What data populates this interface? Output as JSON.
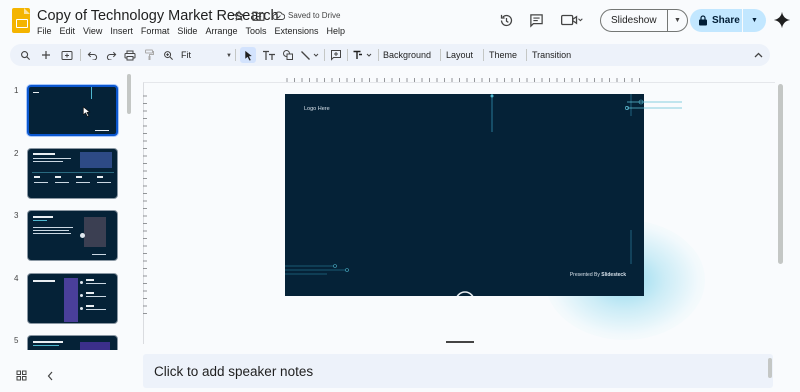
{
  "app": {
    "title": "Copy of Technology Market Research",
    "save_status": "Saved to Drive",
    "menu": [
      "File",
      "Edit",
      "View",
      "Insert",
      "Format",
      "Slide",
      "Arrange",
      "Tools",
      "Extensions",
      "Help"
    ],
    "slideshow_label": "Slideshow",
    "share_label": "Share"
  },
  "toolbar": {
    "zoom_label": "Fit",
    "background_label": "Background",
    "layout_label": "Layout",
    "theme_label": "Theme",
    "transition_label": "Transition"
  },
  "filmstrip": {
    "slides": [
      {
        "number": "1",
        "selected": true
      },
      {
        "number": "2",
        "selected": false
      },
      {
        "number": "3",
        "selected": false
      },
      {
        "number": "4",
        "selected": false
      },
      {
        "number": "5",
        "selected": false
      }
    ]
  },
  "slide": {
    "logo_text": "Logo Here",
    "footer_prefix": "Presented By",
    "footer_brand": "Slidesteck"
  },
  "notes": {
    "placeholder": "Click to add speaker notes"
  },
  "colors": {
    "slide_bg": "#052237",
    "accent_line": "#4fb8cf",
    "share_bg": "#c2e7ff",
    "selection": "#0b57d0"
  }
}
